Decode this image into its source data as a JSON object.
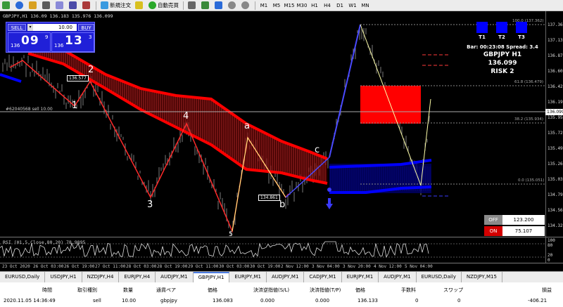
{
  "toolbar": {
    "new_order": "新規注文",
    "auto_trade": "自動売買",
    "timeframes": [
      "M1",
      "M5",
      "M15",
      "M30",
      "H1",
      "H4",
      "D1",
      "W1",
      "MN"
    ]
  },
  "chart": {
    "title": "GBPJPY,H1  136.09  136.183 135.976 136.099",
    "trade_panel": {
      "sell_label": "SELL",
      "buy_label": "BUY",
      "lot": "10.00",
      "sell_small": "136",
      "sell_big": "09",
      "sell_sup": "9",
      "buy_small": "136",
      "buy_big": "13",
      "buy_sup": "3"
    },
    "t_buttons": [
      "T1",
      "T2",
      "T3"
    ],
    "info": {
      "bar": "Bar: 00:23:08  Spread: 3.4",
      "symbol": "GBPJPY H1",
      "price": "136.099",
      "risk": "RISK 2"
    },
    "order_line": "#62040568 sell 10.00",
    "fib_labels": {
      "top": "100.0 (137.362)",
      "f618": "61.8 (136.479)",
      "f382": "38.2 (135.934)",
      "f0": "0.0 (135.051)"
    },
    "wave_labels": [
      "1",
      "2",
      "3",
      "4",
      "5",
      "a",
      "b",
      "c"
    ],
    "price_boxes": {
      "low_box": "134.861",
      "high_box": "136.577"
    },
    "price_axis": [
      "137.362",
      "137.135",
      "136.870",
      "136.605",
      "136.420",
      "136.190",
      "135.955",
      "135.725",
      "135.490",
      "135.260",
      "135.030",
      "134.790",
      "134.560",
      "134.325"
    ],
    "current_price": "136.099",
    "offon": {
      "off_label": "OFF",
      "off_value": "123.200",
      "on_label": "ON",
      "on_value": "75.107"
    },
    "colors": {
      "band_red": "#ff0000",
      "band_blue": "#0000ff",
      "off_gray": "#8a8a8a",
      "on_red": "#d40000"
    }
  },
  "rsi": {
    "title": "RSI (H1,5,Close,80,20) 78.9895",
    "axis": [
      "100",
      "80",
      "20",
      "0"
    ]
  },
  "time_axis": [
    "23 Oct 2020",
    "26 Oct 03:00",
    "26 Oct 19:00",
    "27 Oct 11:00",
    "28 Oct 03:00",
    "28 Oct 19:00",
    "29 Oct 11:00",
    "30 Oct 03:00",
    "30 Oct 19:00",
    "2 Nov 12:00",
    "3 Nov 04:00",
    "3 Nov 20:00",
    "4 Nov 12:00",
    "5 Nov 04:00"
  ],
  "tabs": [
    "EURUSD,Daily",
    "USDJPY,H1",
    "NZDJPY,H4",
    "EURJPY,H4",
    "AUDJPY,M1",
    "GBPJPY,H1",
    "EURJPY,M1",
    "AUDJPY,M1",
    "CADJPY,M1",
    "EURJPY,M1",
    "AUDJPY,M1",
    "EURUSD,Daily",
    "NZDJPY,M15"
  ],
  "active_tab": "GBPJPY,H1",
  "positions": {
    "headers": [
      "時間",
      "取引種別",
      "数量",
      "通貨ペア",
      "価格",
      "決済逆指値(S/L)",
      "決済指値(T/P)",
      "価格",
      "手数料",
      "スワップ",
      "損益"
    ],
    "row": [
      "2020.11.05 14:36:49",
      "sell",
      "10.00",
      "gbpjpy",
      "136.083",
      "0.000",
      "0.000",
      "136.133",
      "0",
      "0",
      "-406.21"
    ]
  }
}
